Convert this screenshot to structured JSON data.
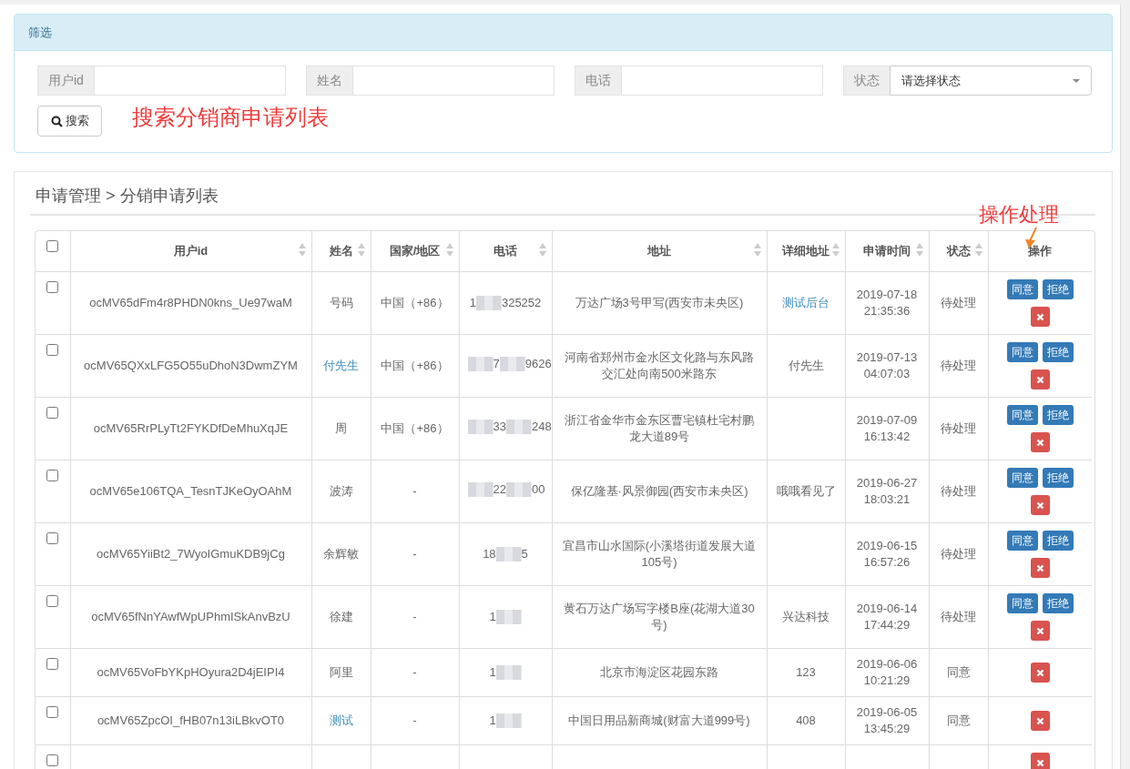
{
  "filter_panel": {
    "title": "筛选",
    "fields": [
      {
        "kind": "text",
        "label": "用户id"
      },
      {
        "kind": "text",
        "label": "姓名"
      },
      {
        "kind": "text",
        "label": "电话"
      },
      {
        "kind": "select",
        "label": "状态",
        "value": "请选择状态"
      }
    ],
    "search_button": "搜索",
    "annotation": "搜索分销商申请列表"
  },
  "list_panel": {
    "title": "申请管理 > 分销申请列表",
    "annotation": "操作处理",
    "table": {
      "select_all": {
        "checked": false
      },
      "columns": [
        {
          "label": "用户id",
          "sortable": true
        },
        {
          "label": "姓名",
          "sortable": true
        },
        {
          "label": "国家/地区",
          "sortable": true
        },
        {
          "label": "电话",
          "sortable": true
        },
        {
          "label": "地址",
          "sortable": true
        },
        {
          "label": "详细地址",
          "sortable": true
        },
        {
          "label": "申请时间",
          "sortable": true
        },
        {
          "label": "状态",
          "sortable": true
        },
        {
          "label": "操作",
          "sortable": false
        }
      ],
      "rows": [
        {
          "checked": false,
          "user_id": "ocMV65dFm4r8PHDN0kns_Ue97waM",
          "name": "号码",
          "name_link": false,
          "region": "中国（+86）",
          "phone": [
            {
              "kind": "text",
              "text": "1"
            },
            {
              "kind": "blur"
            },
            {
              "kind": "text",
              "text": "325252"
            }
          ],
          "address": "万达广场3号甲写(西安市未央区)",
          "detail": "测试后台",
          "detail_link": true,
          "time": [
            "2019-07-18",
            "21:35:36"
          ],
          "status": "待处理",
          "actions": [
            {
              "kind": "agree",
              "label": "同意"
            },
            {
              "kind": "reject",
              "label": "拒绝"
            },
            {
              "kind": "delete"
            }
          ]
        },
        {
          "checked": false,
          "user_id": "ocMV65QXxLFG5O55uDhoN3DwmZYM",
          "name": "付先生",
          "name_link": true,
          "region": "中国（+86）",
          "phone": [
            {
              "kind": "blur"
            },
            {
              "kind": "text",
              "text": "7"
            },
            {
              "kind": "blur"
            },
            {
              "kind": "text",
              "text": "9626"
            }
          ],
          "address": "河南省郑州市金水区文化路与东风路交汇处向南500米路东",
          "detail": "付先生",
          "detail_link": false,
          "time": [
            "2019-07-13",
            "04:07:03"
          ],
          "status": "待处理",
          "actions": [
            {
              "kind": "agree",
              "label": "同意"
            },
            {
              "kind": "reject",
              "label": "拒绝"
            },
            {
              "kind": "delete"
            }
          ]
        },
        {
          "checked": false,
          "user_id": "ocMV65RrPLyTt2FYKDfDeMhuXqJE",
          "name": "周",
          "name_link": false,
          "region": "中国（+86）",
          "phone": [
            {
              "kind": "blur"
            },
            {
              "kind": "text",
              "text": "33"
            },
            {
              "kind": "blur"
            },
            {
              "kind": "text",
              "text": "248"
            }
          ],
          "address": "浙江省金华市金东区曹宅镇杜宅村鹏龙大道89号",
          "time": [
            "2019-07-09",
            "16:13:42"
          ],
          "status": "待处理",
          "actions": [
            {
              "kind": "agree",
              "label": "同意"
            },
            {
              "kind": "reject",
              "label": "拒绝"
            },
            {
              "kind": "delete"
            }
          ]
        },
        {
          "checked": false,
          "user_id": "ocMV65e106TQA_TesnTJKeOyOAhM",
          "name": "波涛",
          "name_link": false,
          "region": "-",
          "phone": [
            {
              "kind": "blur"
            },
            {
              "kind": "text",
              "text": "22"
            },
            {
              "kind": "blur"
            },
            {
              "kind": "text",
              "text": "00"
            }
          ],
          "address": "保亿隆基·风景御园(西安市未央区)",
          "detail": "哦哦看见了",
          "detail_link": false,
          "time": [
            "2019-06-27",
            "18:03:21"
          ],
          "status": "待处理",
          "actions": [
            {
              "kind": "agree",
              "label": "同意"
            },
            {
              "kind": "reject",
              "label": "拒绝"
            },
            {
              "kind": "delete"
            }
          ]
        },
        {
          "checked": false,
          "user_id": "ocMV65YiiBt2_7WyoIGmuKDB9jCg",
          "name": "余辉敏",
          "name_link": false,
          "region": "-",
          "phone": [
            {
              "kind": "text",
              "text": "18"
            },
            {
              "kind": "blur"
            },
            {
              "kind": "text",
              "text": "5"
            }
          ],
          "address": "宜昌市山水国际(小溪塔街道发展大道105号)",
          "time": [
            "2019-06-15",
            "16:57:26"
          ],
          "status": "待处理",
          "actions": [
            {
              "kind": "agree",
              "label": "同意"
            },
            {
              "kind": "reject",
              "label": "拒绝"
            },
            {
              "kind": "delete"
            }
          ]
        },
        {
          "checked": false,
          "user_id": "ocMV65fNnYAwfWpUPhmISkAnvBzU",
          "name": "徐建",
          "name_link": false,
          "region": "-",
          "phone": [
            {
              "kind": "text",
              "text": "1"
            },
            {
              "kind": "blur"
            }
          ],
          "address": "黄石万达广场写字楼B座(花湖大道30号)",
          "detail": "兴达科技",
          "detail_link": false,
          "time": [
            "2019-06-14",
            "17:44:29"
          ],
          "status": "待处理",
          "actions": [
            {
              "kind": "agree",
              "label": "同意"
            },
            {
              "kind": "reject",
              "label": "拒绝"
            },
            {
              "kind": "delete"
            }
          ]
        },
        {
          "checked": false,
          "user_id": "ocMV65VoFbYKpHOyura2D4jEIPI4",
          "name": "阿里",
          "name_link": false,
          "region": "-",
          "phone": [
            {
              "kind": "text",
              "text": "1"
            },
            {
              "kind": "blur"
            }
          ],
          "address": "北京市海淀区花园东路",
          "detail": "123",
          "detail_link": false,
          "time": [
            "2019-06-06",
            "10:21:29"
          ],
          "status": "同意",
          "actions": [
            {
              "kind": "delete"
            }
          ]
        },
        {
          "checked": false,
          "user_id": "ocMV65ZpcOI_fHB07n13iLBkvOT0",
          "name": "测试",
          "name_link": true,
          "region": "-",
          "phone": [
            {
              "kind": "text",
              "text": "1"
            },
            {
              "kind": "blur"
            }
          ],
          "address": "中国日用品新商城(财富大道999号)",
          "detail": "408",
          "detail_link": false,
          "time": [
            "2019-06-05",
            "13:45:29"
          ],
          "status": "同意",
          "actions": [
            {
              "kind": "delete"
            }
          ]
        },
        {
          "checked": false,
          "actions": [
            {
              "kind": "delete"
            }
          ]
        }
      ]
    }
  }
}
